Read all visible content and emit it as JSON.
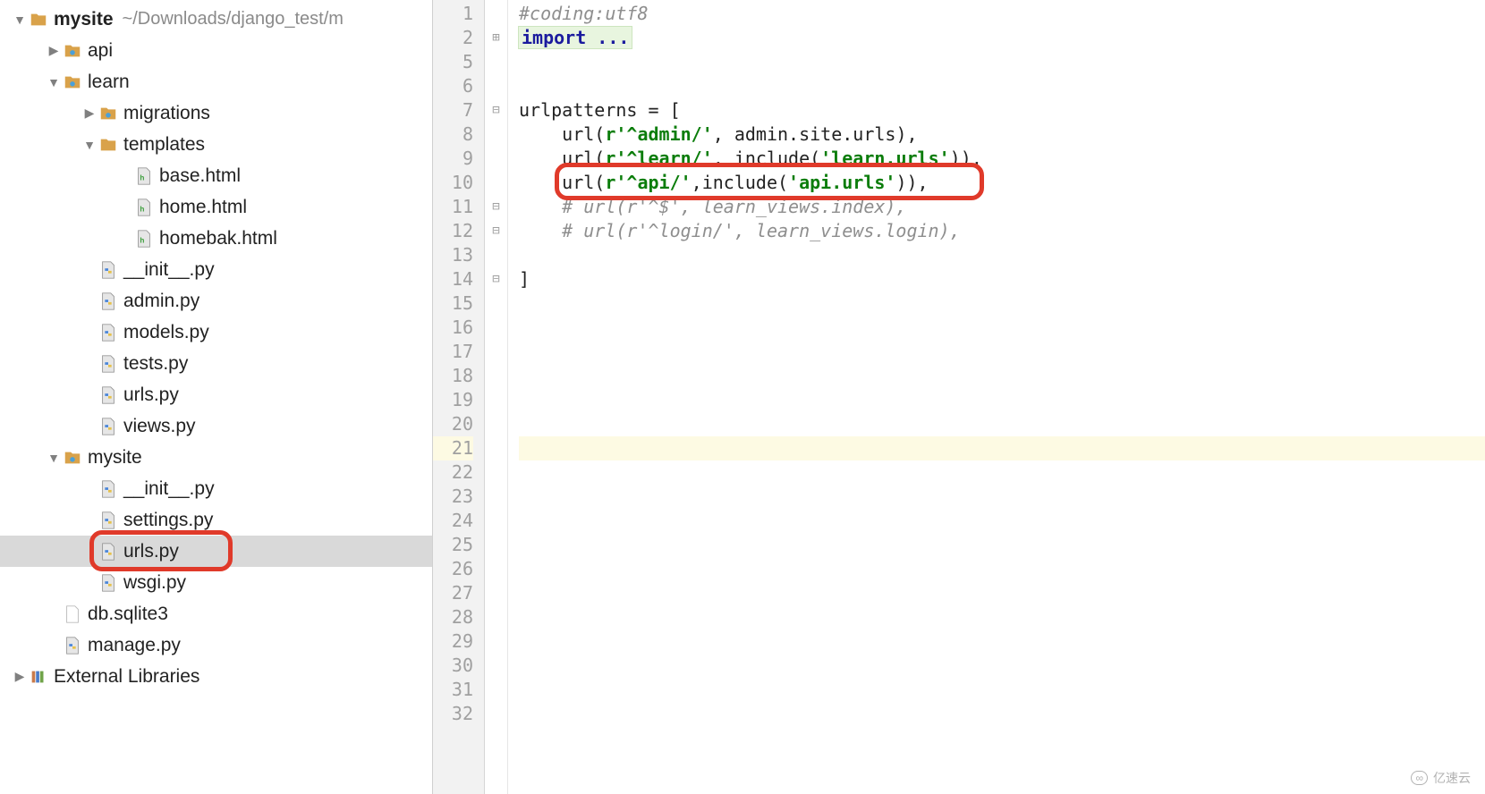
{
  "project": {
    "root": {
      "name": "mysite",
      "hint": "~/Downloads/django_test/m"
    }
  },
  "tree": [
    {
      "indent": 0,
      "type": "folder-root",
      "exp": "down",
      "label": "mysite",
      "hint": "~/Downloads/django_test/m",
      "bold": true
    },
    {
      "indent": 1,
      "type": "pkg",
      "exp": "right",
      "label": "api"
    },
    {
      "indent": 1,
      "type": "pkg",
      "exp": "down",
      "label": "learn"
    },
    {
      "indent": 2,
      "type": "pkg",
      "exp": "right",
      "label": "migrations"
    },
    {
      "indent": 2,
      "type": "folder",
      "exp": "down",
      "label": "templates"
    },
    {
      "indent": 3,
      "type": "html",
      "exp": "",
      "label": "base.html"
    },
    {
      "indent": 3,
      "type": "html",
      "exp": "",
      "label": "home.html"
    },
    {
      "indent": 3,
      "type": "html",
      "exp": "",
      "label": "homebak.html"
    },
    {
      "indent": 2,
      "type": "py",
      "exp": "",
      "label": "__init__.py"
    },
    {
      "indent": 2,
      "type": "py",
      "exp": "",
      "label": "admin.py"
    },
    {
      "indent": 2,
      "type": "py",
      "exp": "",
      "label": "models.py"
    },
    {
      "indent": 2,
      "type": "py",
      "exp": "",
      "label": "tests.py"
    },
    {
      "indent": 2,
      "type": "py",
      "exp": "",
      "label": "urls.py"
    },
    {
      "indent": 2,
      "type": "py",
      "exp": "",
      "label": "views.py"
    },
    {
      "indent": 1,
      "type": "pkg",
      "exp": "down",
      "label": "mysite"
    },
    {
      "indent": 2,
      "type": "py",
      "exp": "",
      "label": "__init__.py"
    },
    {
      "indent": 2,
      "type": "py",
      "exp": "",
      "label": "settings.py"
    },
    {
      "indent": 2,
      "type": "py",
      "exp": "",
      "label": "urls.py",
      "selected": true,
      "highlighted": true
    },
    {
      "indent": 2,
      "type": "py",
      "exp": "",
      "label": "wsgi.py"
    },
    {
      "indent": 1,
      "type": "file",
      "exp": "",
      "label": "db.sqlite3"
    },
    {
      "indent": 1,
      "type": "py",
      "exp": "",
      "label": "manage.py"
    },
    {
      "indent": 0,
      "type": "lib",
      "exp": "right",
      "label": "External Libraries"
    }
  ],
  "editor": {
    "line_numbers": [
      1,
      2,
      5,
      6,
      7,
      8,
      9,
      10,
      11,
      12,
      13,
      14,
      15,
      16,
      17,
      18,
      19,
      20,
      21,
      22,
      23,
      24,
      25,
      26,
      27,
      28,
      29,
      30,
      31,
      32
    ],
    "current_line": 21,
    "lines": {
      "1": {
        "segs": [
          {
            "t": "#coding:utf8",
            "c": "c-comment"
          }
        ]
      },
      "2": {
        "segs": [
          {
            "t": "import ...",
            "c": "c-kw c-fold"
          }
        ],
        "fold": "+"
      },
      "5": {
        "segs": []
      },
      "6": {
        "segs": []
      },
      "7": {
        "segs": [
          {
            "t": "urlpatterns = [",
            "c": ""
          }
        ],
        "fold": "-"
      },
      "8": {
        "segs": [
          {
            "t": "    url(",
            "c": ""
          },
          {
            "t": "r'^admin/'",
            "c": "c-str"
          },
          {
            "t": ", admin.site.urls),",
            "c": ""
          }
        ]
      },
      "9": {
        "segs": [
          {
            "t": "    url(",
            "c": ""
          },
          {
            "t": "r'^learn/'",
            "c": "c-str"
          },
          {
            "t": ", include(",
            "c": ""
          },
          {
            "t": "'learn.urls'",
            "c": "c-str"
          },
          {
            "t": ")),",
            "c": ""
          }
        ]
      },
      "10": {
        "segs": [
          {
            "t": "    url(",
            "c": ""
          },
          {
            "t": "r'^api/'",
            "c": "c-str"
          },
          {
            "t": ",include(",
            "c": ""
          },
          {
            "t": "'api.urls'",
            "c": "c-str"
          },
          {
            "t": ")),",
            "c": ""
          }
        ],
        "highlighted": true
      },
      "11": {
        "segs": [
          {
            "t": "    # url(r'^$', learn_views.index),",
            "c": "c-comment"
          }
        ],
        "fold": "-"
      },
      "12": {
        "segs": [
          {
            "t": "    # url(r'^login/', learn_views.login),",
            "c": "c-comment"
          }
        ],
        "fold": "-"
      },
      "13": {
        "segs": []
      },
      "14": {
        "segs": [
          {
            "t": "]",
            "c": ""
          }
        ],
        "fold": "-"
      },
      "15": {
        "segs": []
      },
      "16": {
        "segs": []
      },
      "17": {
        "segs": []
      },
      "18": {
        "segs": []
      },
      "19": {
        "segs": []
      },
      "20": {
        "segs": []
      },
      "21": {
        "segs": [],
        "current": true
      },
      "22": {
        "segs": []
      },
      "23": {
        "segs": []
      },
      "24": {
        "segs": []
      },
      "25": {
        "segs": []
      },
      "26": {
        "segs": []
      },
      "27": {
        "segs": []
      },
      "28": {
        "segs": []
      },
      "29": {
        "segs": []
      },
      "30": {
        "segs": []
      },
      "31": {
        "segs": []
      },
      "32": {
        "segs": []
      }
    }
  },
  "watermark": "亿速云"
}
